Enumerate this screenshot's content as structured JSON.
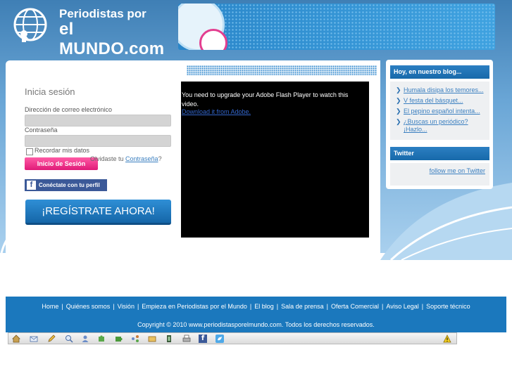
{
  "brand": {
    "line1": "Periodistas por",
    "line2": "el MUNDO.com"
  },
  "login": {
    "title": "Inicia sesión",
    "email_label": "Dirección de correo electrónico",
    "email_value": "",
    "password_label": "Contraseña",
    "password_value": "",
    "remember_label": "Recordar mis datos",
    "submit_label": "Inicio de Sesión",
    "forgot_prefix": "Olvidaste tu ",
    "forgot_link": "Contraseña",
    "forgot_suffix": "?",
    "facebook_label": "Conéctate con tu perfil",
    "facebook_icon": "f",
    "register_label": "¡REGÍSTRATE AHORA!"
  },
  "flash": {
    "message": "You need to upgrade your Adobe Flash Player to watch this video.",
    "download_link": "Download it from Adobe."
  },
  "blog": {
    "title": "Hoy, en nuestro blog...",
    "items": [
      "Humala disipa los temores...",
      "V festa del básquet...",
      "El pepino español intenta...",
      "¿Buscas un periódico? ¡Hazlo..."
    ]
  },
  "twitter": {
    "title": "Twitter",
    "follow_link": "follow me on Twitter"
  },
  "footer": {
    "links": [
      "Home",
      "Quiénes somos",
      "Visión",
      "Empieza en Periodistas por el Mundo",
      "El blog",
      "Sala de prensa",
      "Oferta Comercial",
      "Aviso Legal",
      "Soporte técnico"
    ],
    "separator": "|",
    "copyright": "Copyright © 2010 www.periodistasporelmundo.com. Todos los derechos reservados."
  },
  "toolbar": {
    "icons": [
      "home-icon",
      "email-icon",
      "edit-icon",
      "search-icon",
      "user-icon",
      "puzzle-icon",
      "puzzle-icon",
      "network-icon",
      "folder-icon",
      "film-icon",
      "print-icon",
      "facebook-icon",
      "twitter-icon"
    ],
    "warning_icon": "warning-icon"
  },
  "colors": {
    "accent": "#1b78bd",
    "pink": "#e01b78",
    "facebook": "#3b5998"
  }
}
